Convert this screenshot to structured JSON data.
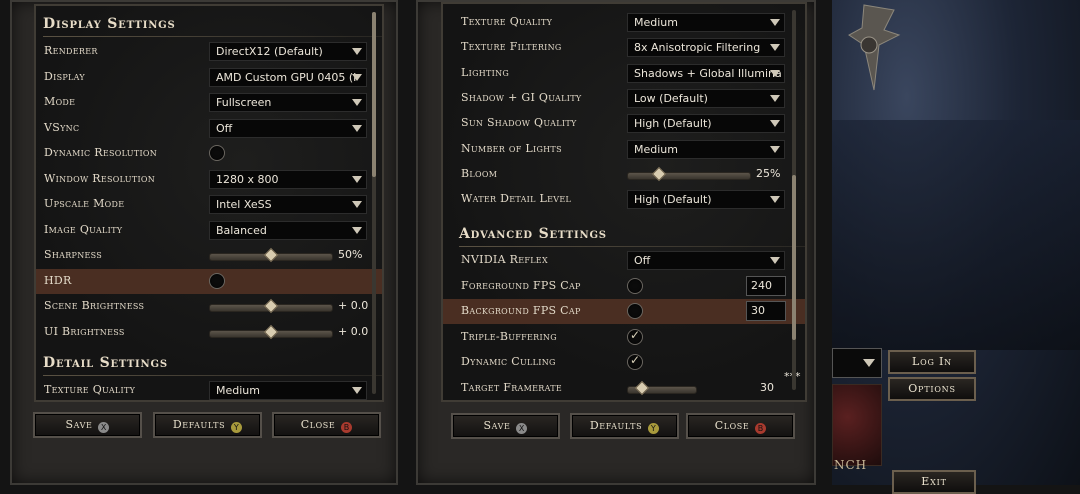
{
  "left": {
    "section_display": "Display Settings",
    "rows": [
      {
        "label": "Renderer",
        "type": "dropdown",
        "value": "DirectX12 (Default)"
      },
      {
        "label": "Display",
        "type": "dropdown",
        "value": "AMD Custom GPU 0405 (I"
      },
      {
        "label": "Mode",
        "type": "dropdown",
        "value": "Fullscreen"
      },
      {
        "label": "VSync",
        "type": "dropdown",
        "value": "Off"
      },
      {
        "label": "Dynamic Resolution",
        "type": "checkbox",
        "checked": false
      },
      {
        "label": "Window Resolution",
        "type": "dropdown",
        "value": "1280 x 800"
      },
      {
        "label": "Upscale Mode",
        "type": "dropdown",
        "value": "Intel XeSS"
      },
      {
        "label": "Image Quality",
        "type": "dropdown",
        "value": "Balanced"
      },
      {
        "label": "Sharpness",
        "type": "slider",
        "value": "50%",
        "level": 0.5
      },
      {
        "label": "HDR",
        "type": "checkbox",
        "checked": false
      },
      {
        "label": "Scene Brightness",
        "type": "slider",
        "value": "+ 0.0",
        "level": 0.5
      },
      {
        "label": "UI Brightness",
        "type": "slider",
        "value": "+ 0.0",
        "level": 0.5
      }
    ],
    "section_detail": "Detail Settings",
    "detail_row": {
      "label": "Texture Quality",
      "value": "Medium"
    },
    "buttons": {
      "save": "Save",
      "defaults": "Defaults",
      "close": "Close"
    }
  },
  "right": {
    "rows": [
      {
        "label": "Texture Quality",
        "type": "dropdown",
        "value": "Medium"
      },
      {
        "label": "Texture Filtering",
        "type": "dropdown",
        "value": "8x Anisotropic Filtering"
      },
      {
        "label": "Lighting",
        "type": "dropdown",
        "value": "Shadows + Global Illumina"
      },
      {
        "label": "Shadow + GI Quality",
        "type": "dropdown",
        "value": "Low (Default)"
      },
      {
        "label": "Sun Shadow Quality",
        "type": "dropdown",
        "value": "High (Default)"
      },
      {
        "label": "Number of Lights",
        "type": "dropdown",
        "value": "Medium"
      },
      {
        "label": "Bloom",
        "type": "slider",
        "value": "25%",
        "level": 0.25
      },
      {
        "label": "Water Detail Level",
        "type": "dropdown",
        "value": "High (Default)"
      }
    ],
    "section_advanced": "Advanced Settings",
    "adv_rows": [
      {
        "label": "NVIDIA Reflex",
        "type": "dropdown",
        "value": "Off"
      },
      {
        "label": "Foreground FPS Cap",
        "type": "checknum",
        "checked": false,
        "value": "240"
      },
      {
        "label": "Background FPS Cap",
        "type": "checknum",
        "checked": false,
        "value": "30"
      },
      {
        "label": "Triple-Buffering",
        "type": "checkbox",
        "checked": true
      },
      {
        "label": "Dynamic Culling",
        "type": "checkbox",
        "checked": true
      },
      {
        "label": "Target Framerate",
        "type": "slider",
        "value": "30",
        "level": 0.2
      }
    ],
    "stars": "***",
    "buttons": {
      "save": "Save",
      "defaults": "Defaults",
      "close": "Close"
    }
  },
  "scene": {
    "login": "Log In",
    "options": "Options",
    "exit": "Exit",
    "nch": "NCH"
  },
  "icons": {
    "x": "X",
    "y": "Y",
    "b": "B"
  }
}
